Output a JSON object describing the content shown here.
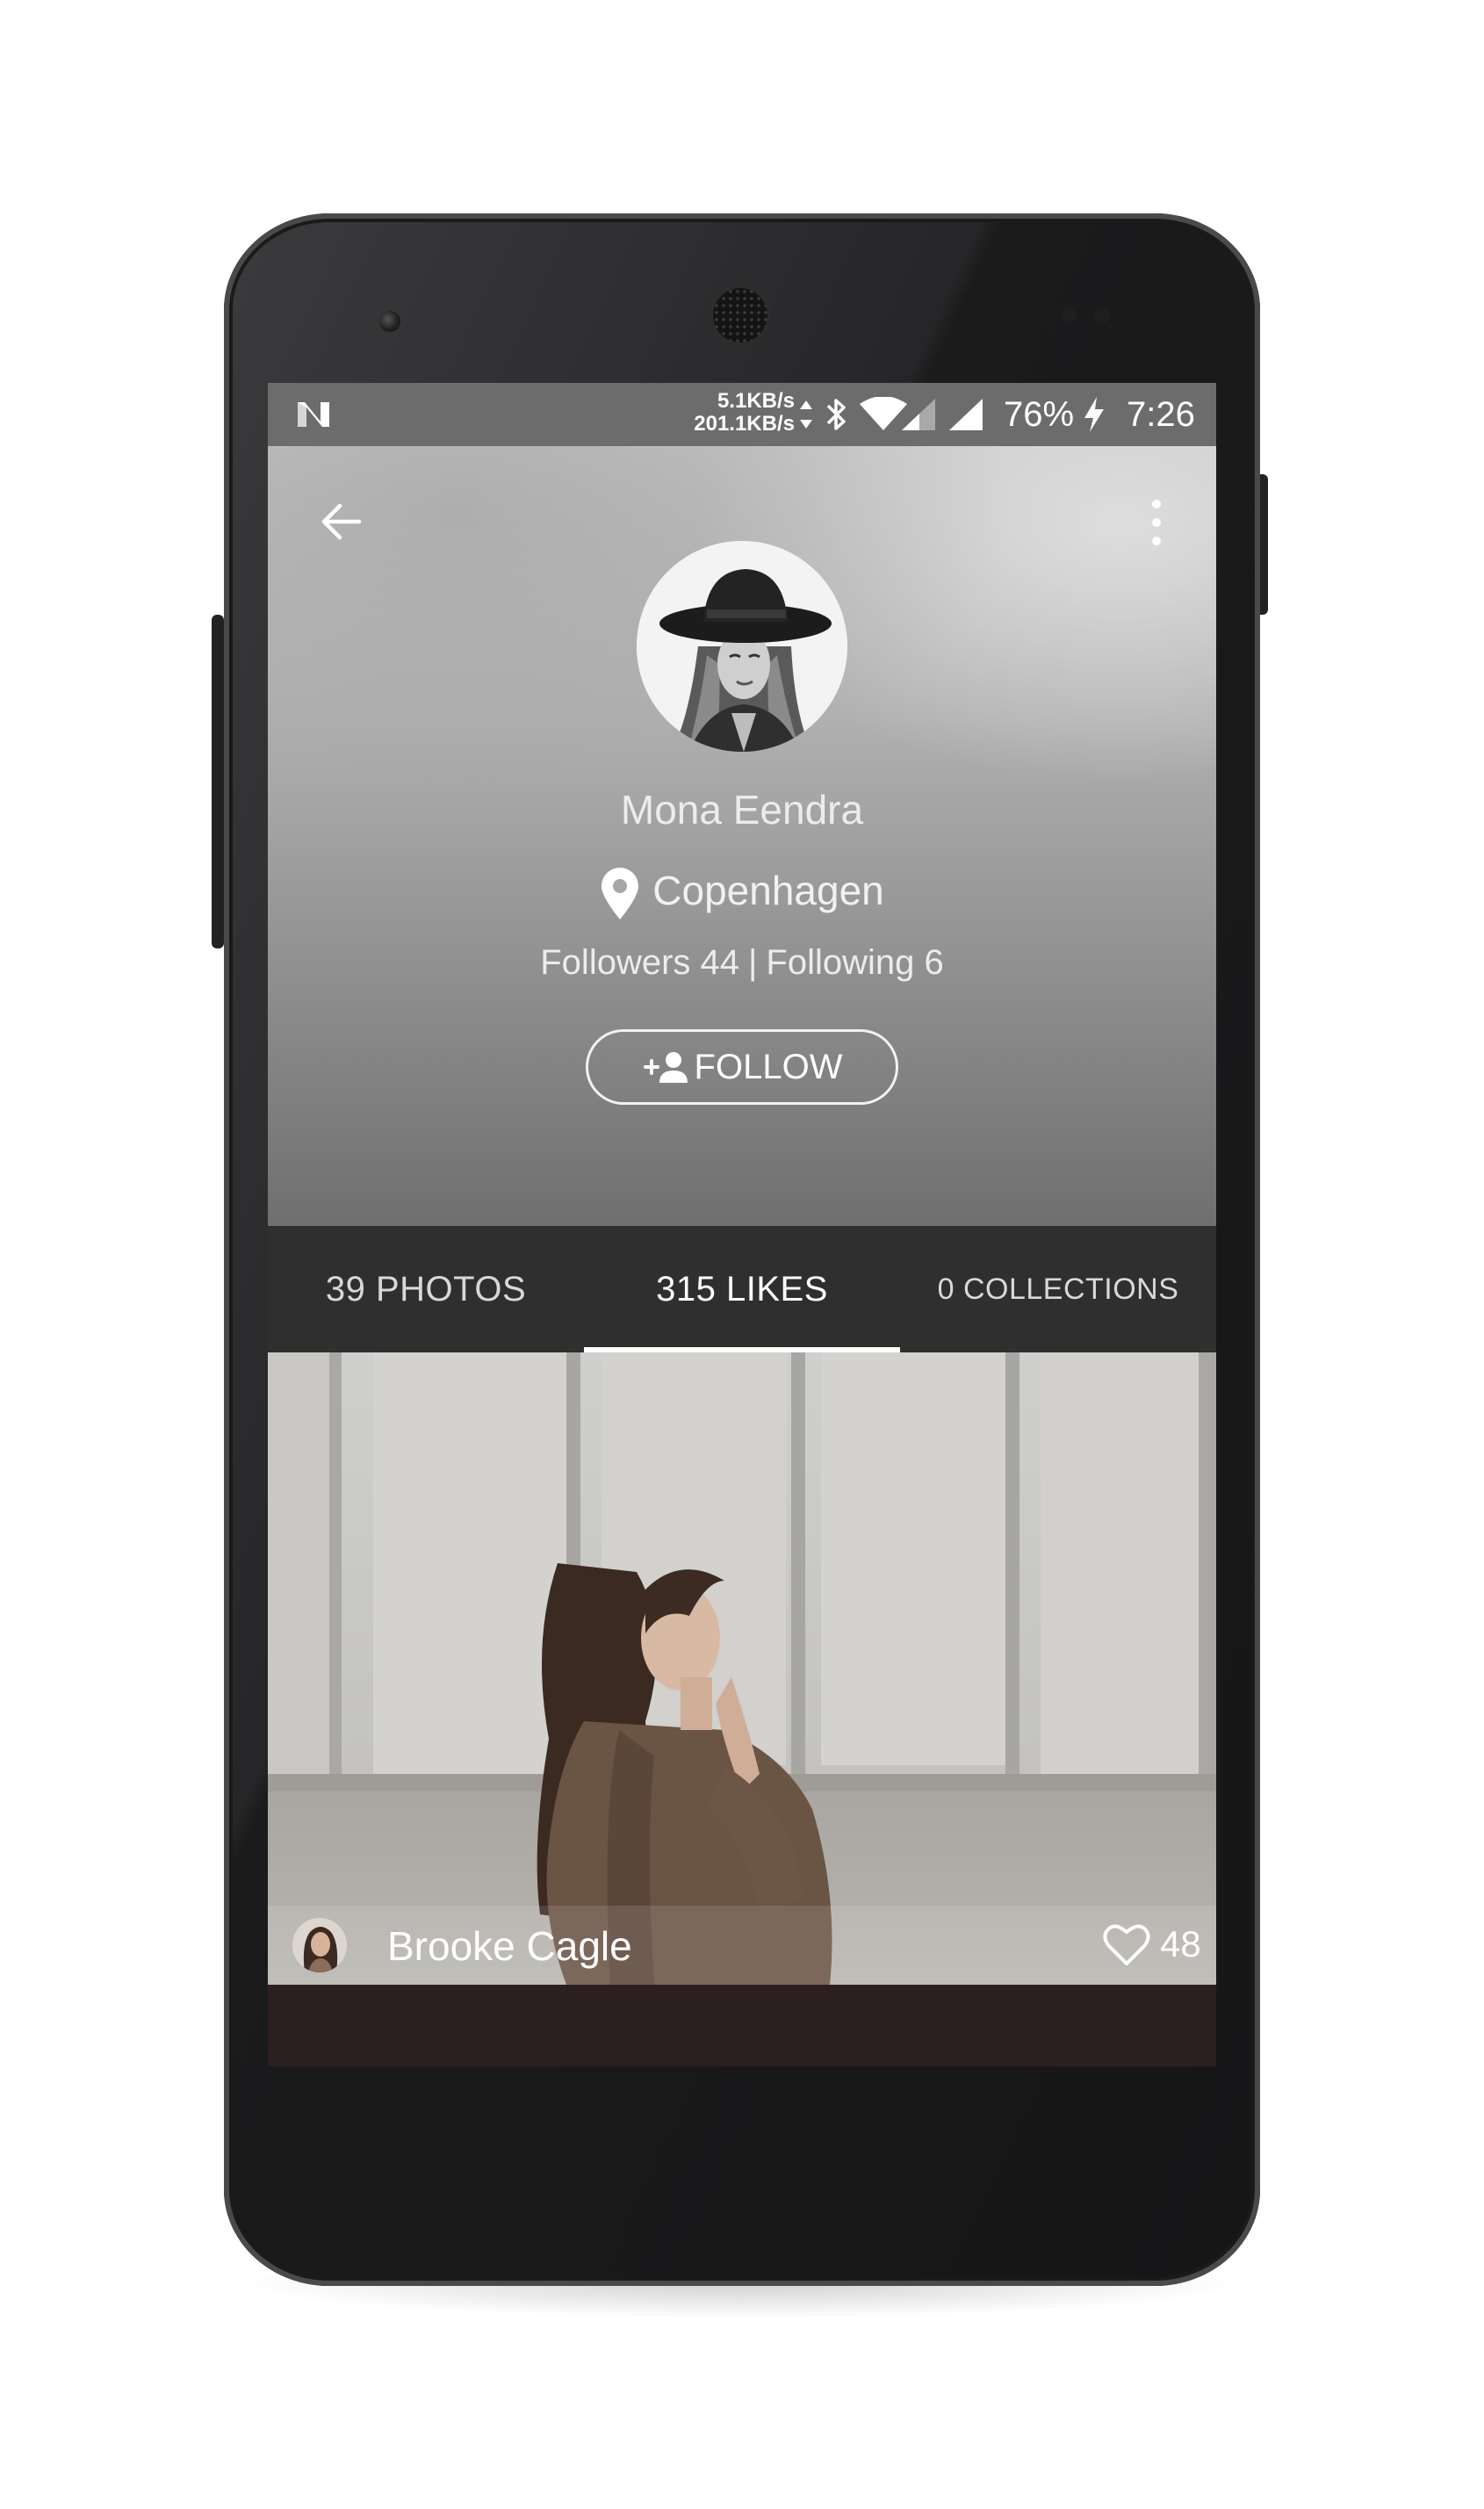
{
  "status_bar": {
    "net_up": "5.1KB/s",
    "net_down": "201.1KB/s",
    "battery": "76%",
    "time": "7:26",
    "icons": [
      "n-notification-icon",
      "bluetooth-icon",
      "wifi-icon",
      "cell-signal-icon",
      "cell-signal-icon",
      "charging-bolt-icon"
    ]
  },
  "toolbar": {
    "back_icon": "arrow-back-icon",
    "menu_icon": "more-vert-icon"
  },
  "profile": {
    "name": "Mona Eendra",
    "location": "Copenhagen",
    "followers_label": "Followers 44",
    "following_label": "Following 6",
    "separator": "|",
    "follow_button": "FOLLOW"
  },
  "tabs": [
    {
      "label": "39 PHOTOS",
      "active": false
    },
    {
      "label": "315 LIKES",
      "active": true
    },
    {
      "label": "0 COLLECTIONS",
      "active": false
    }
  ],
  "photos": [
    {
      "author": "Brooke Cagle",
      "likes": "48"
    }
  ],
  "colors": {
    "tab_bar": "#2f2f30",
    "status_bar": "#6c6c6c",
    "accent_indicator": "#ffffff",
    "phone_body": "#1b1b1c"
  }
}
